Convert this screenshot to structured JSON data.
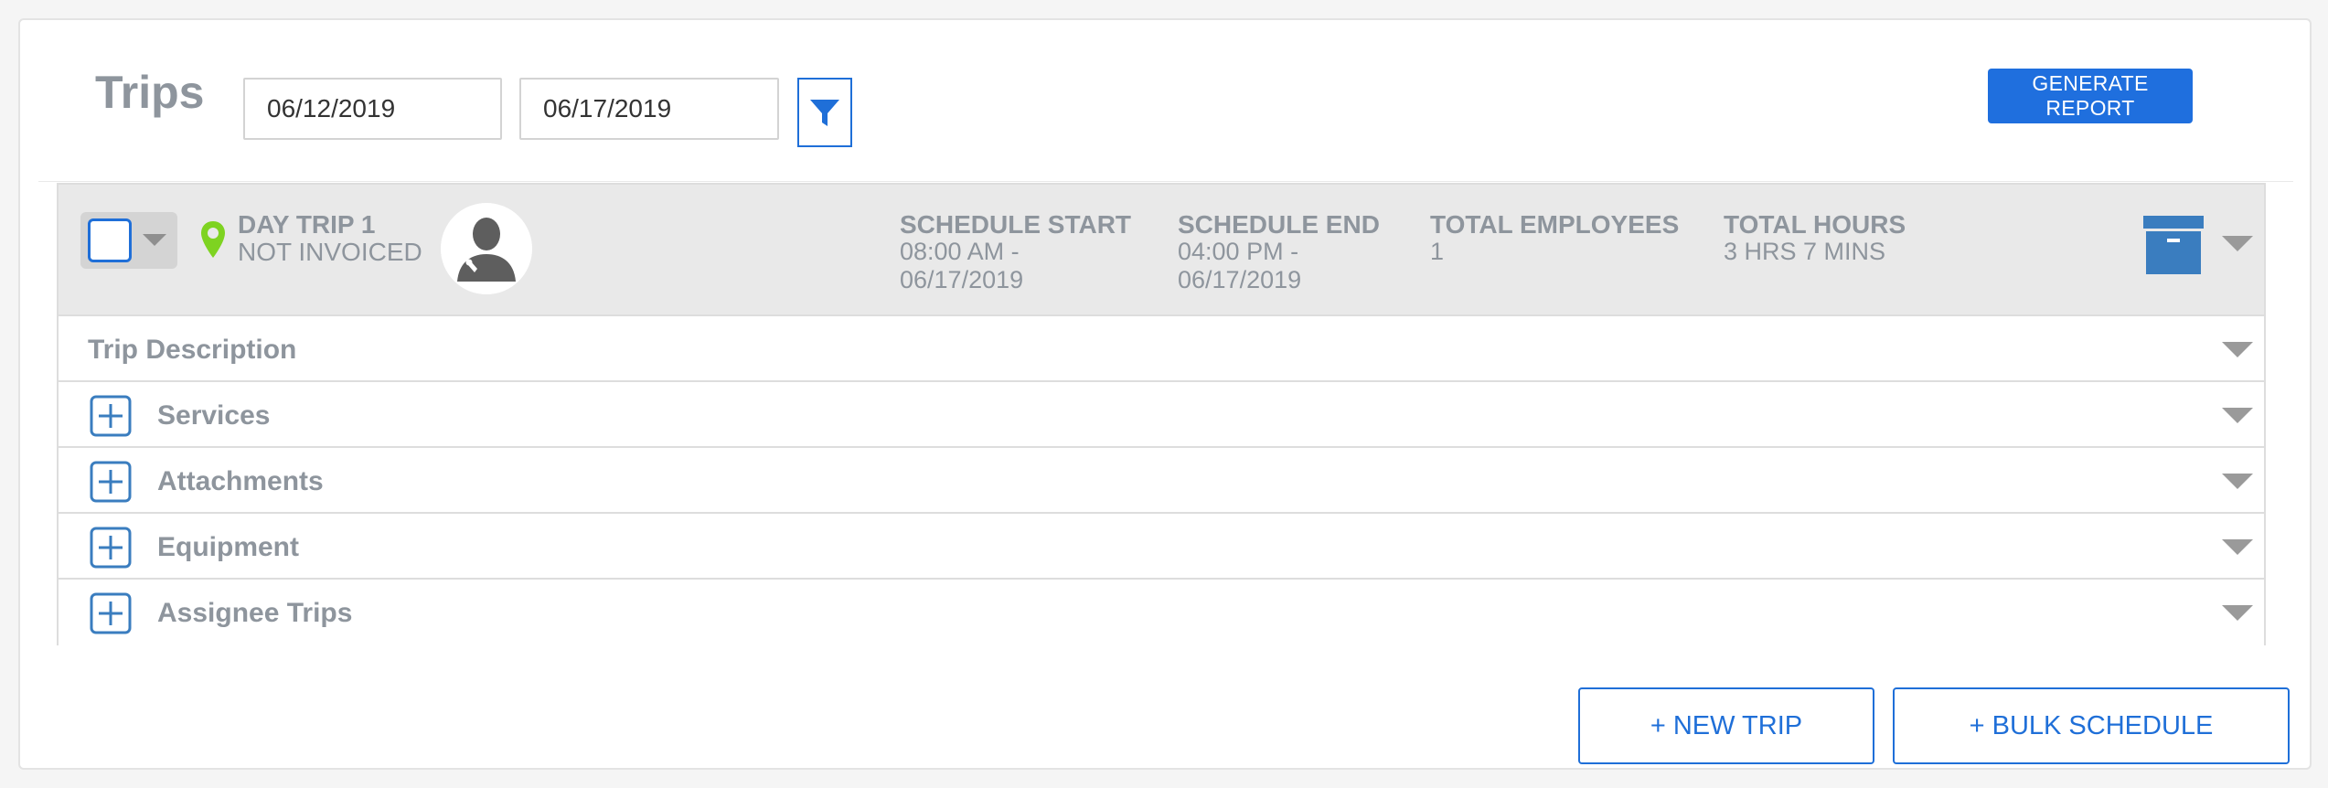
{
  "page": {
    "title": "Trips"
  },
  "filters": {
    "date_from": "06/12/2019",
    "date_to": "06/17/2019",
    "filter_icon": "filter-funnel-icon"
  },
  "actions": {
    "generate_report": "GENERATE REPORT",
    "new_trip": "+ NEW TRIP",
    "bulk_schedule": "+ BULK SCHEDULE"
  },
  "trip": {
    "name": "DAY TRIP 1",
    "status": "NOT INVOICED",
    "columns": {
      "schedule_start_label": "SCHEDULE START",
      "schedule_start_value": "08:00 AM -\n06/17/2019",
      "schedule_end_label": "SCHEDULE END",
      "schedule_end_value": "04:00 PM -\n06/17/2019",
      "total_employees_label": "TOTAL EMPLOYEES",
      "total_employees_value": "1",
      "total_hours_label": "TOTAL HOURS",
      "total_hours_value": "3 HRS 7 MINS"
    },
    "sections": [
      {
        "label": "Trip Description"
      },
      {
        "label": "Services"
      },
      {
        "label": "Attachments"
      },
      {
        "label": "Equipment"
      },
      {
        "label": "Assignee Trips"
      }
    ]
  },
  "colors": {
    "primary": "#1f6fde",
    "pin": "#7ed321",
    "archive": "#3a7dbf",
    "label_gray": "#8e959d",
    "header_bg": "#e9e9e9"
  }
}
